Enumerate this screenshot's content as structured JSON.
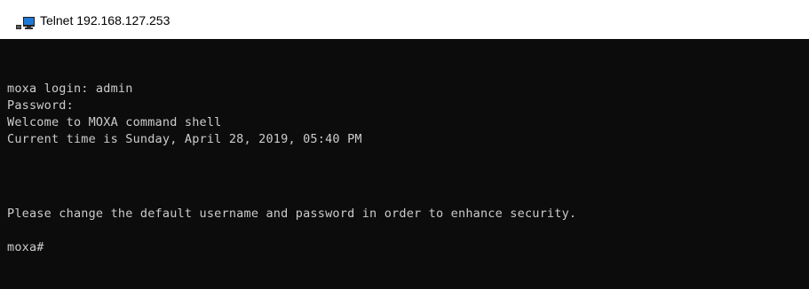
{
  "window": {
    "title": "Telnet 192.168.127.253",
    "icon": "telnet-terminal-icon"
  },
  "terminal": {
    "lines": [
      "moxa login: admin",
      "Password:",
      "Welcome to MOXA command shell",
      "Current time is Sunday, April 28, 2019, 05:40 PM",
      "Please change the default username and password in order to enhance security.",
      "moxa#"
    ],
    "colors": {
      "background": "#0c0c0c",
      "foreground": "#cccccc"
    }
  }
}
